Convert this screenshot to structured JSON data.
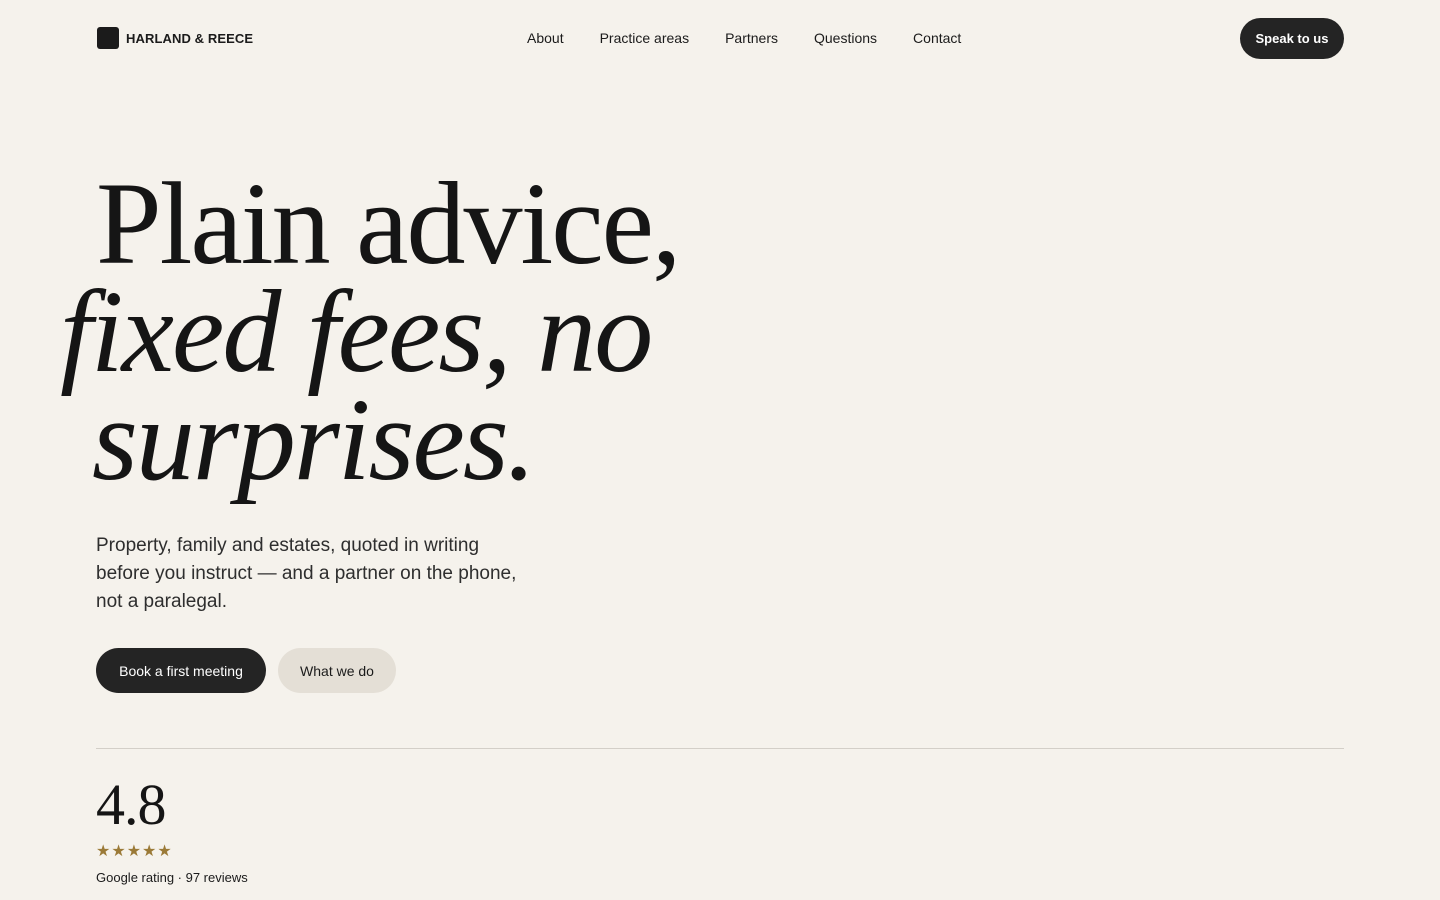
{
  "header": {
    "brand": "HARLAND & REECE",
    "nav": [
      "About",
      "Practice areas",
      "Partners",
      "Questions",
      "Contact"
    ],
    "cta": "Speak to us"
  },
  "hero": {
    "headline_line1": "Plain advice,",
    "headline_line2": "fixed fees, no",
    "headline_line3": "surprises.",
    "lede": "Property, family and estates, quoted in writing before you instruct — and a partner on the phone, not a paralegal.",
    "primary_button": "Book a first meeting",
    "secondary_button": "What we do"
  },
  "rating": {
    "value": "4.8",
    "stars": [
      "★",
      "★",
      "★",
      "★",
      "★"
    ],
    "caption": "Google rating · 97 reviews",
    "star_color": "#9b7a37"
  },
  "colors": {
    "background": "#f5f2ec",
    "dark": "#242424",
    "secondary_button": "#e4dfd6"
  }
}
